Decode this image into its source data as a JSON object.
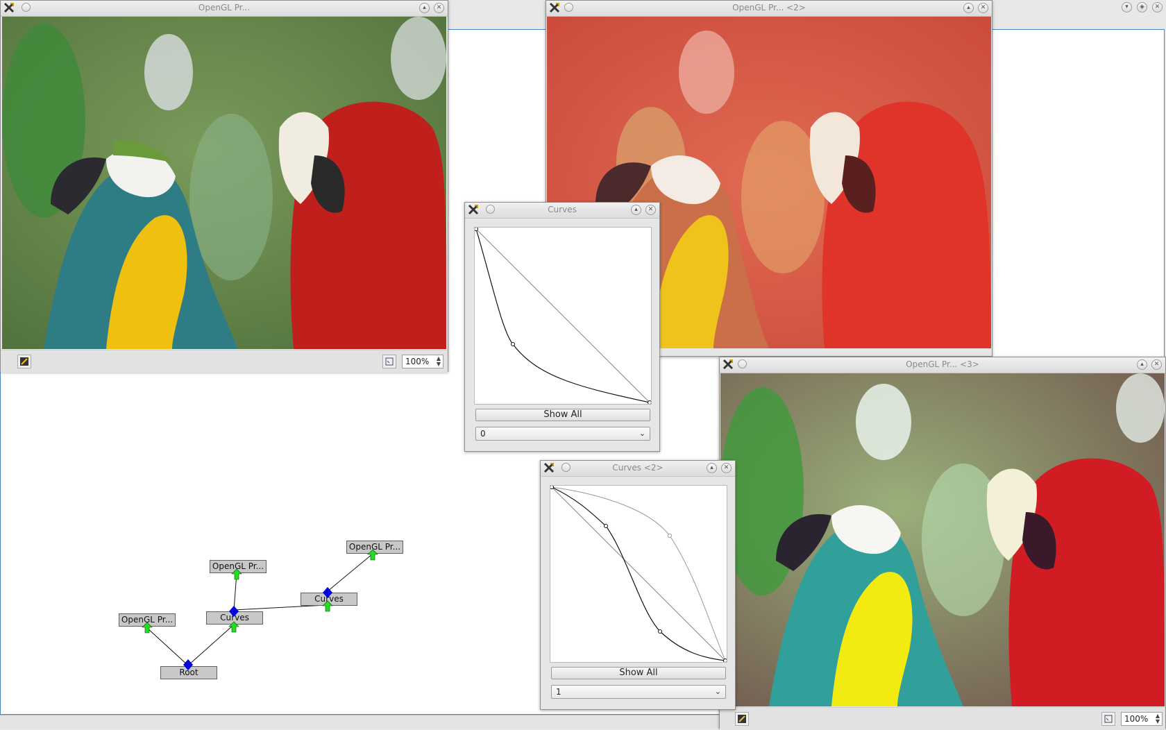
{
  "desktop": {
    "top_right_buttons": [
      "chevron-down",
      "restore",
      "close"
    ]
  },
  "windows": {
    "viewer1": {
      "title": "OpenGL Pr...",
      "zoom": "100%"
    },
    "viewer2": {
      "title": "OpenGL Pr... <2>"
    },
    "viewer3": {
      "title": "OpenGL Pr... <3>",
      "zoom": "100%"
    },
    "curves1": {
      "title": "Curves",
      "show_all": "Show All",
      "channel": "0"
    },
    "curves2": {
      "title": "Curves <2>",
      "show_all": "Show All",
      "channel": "1"
    }
  },
  "graph": {
    "nodes": {
      "root": "Root",
      "curves_a": "Curves",
      "curves_b": "Curves",
      "viewer_a": "OpenGL Pr...",
      "viewer_b": "OpenGL Pr...",
      "viewer_c": "OpenGL Pr..."
    }
  },
  "colors": {
    "port_in": "#0000dd",
    "port_out": "#22dd22",
    "selection_border": "#4a86c6"
  }
}
